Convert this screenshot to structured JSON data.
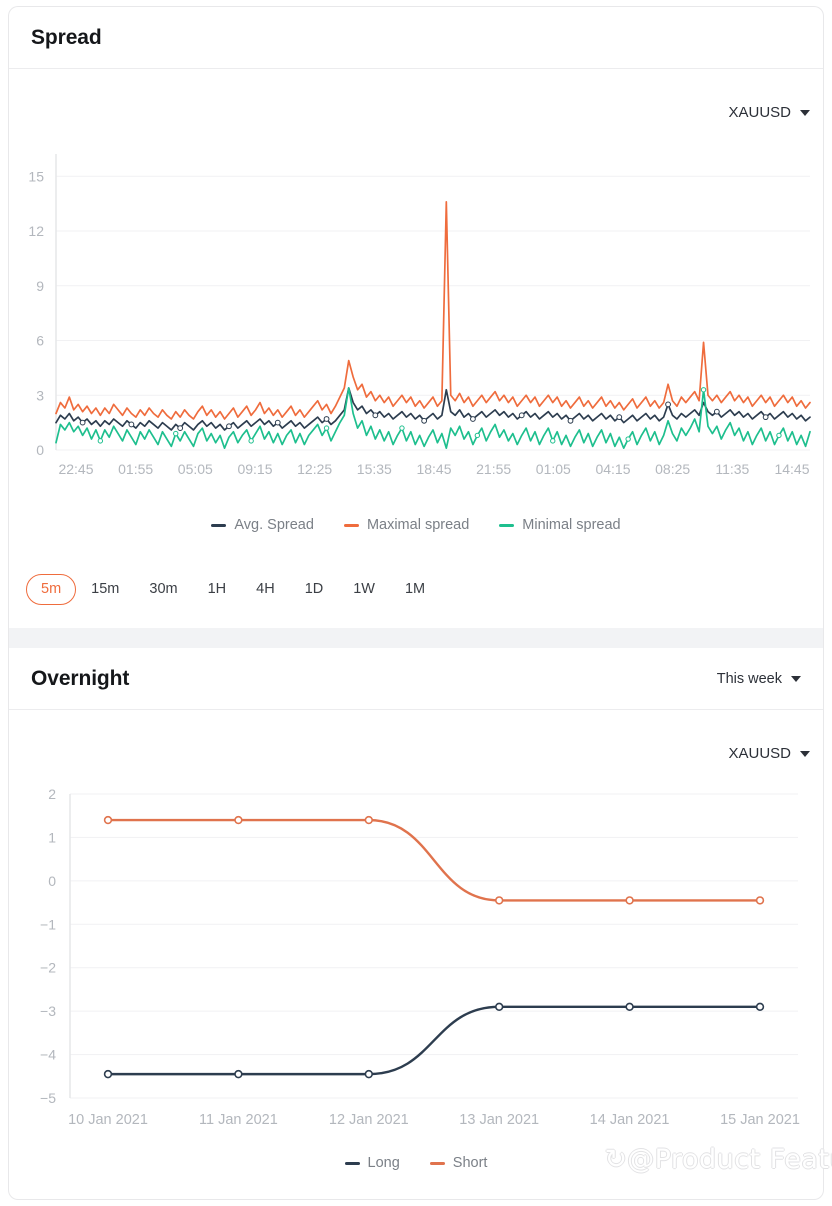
{
  "spread_card": {
    "title": "Spread",
    "symbol": "XAUUSD",
    "symbol_caret_icon": "chevron-down-icon",
    "range_buttons": [
      {
        "label": "5m",
        "active": true
      },
      {
        "label": "15m",
        "active": false
      },
      {
        "label": "30m",
        "active": false
      },
      {
        "label": "1H",
        "active": false
      },
      {
        "label": "4H",
        "active": false
      },
      {
        "label": "1D",
        "active": false
      },
      {
        "label": "1W",
        "active": false
      },
      {
        "label": "1M",
        "active": false
      }
    ]
  },
  "overnight_card": {
    "title": "Overnight",
    "period": "This week",
    "period_caret_icon": "chevron-down-icon",
    "symbol": "XAUUSD",
    "symbol_caret_icon": "chevron-down-icon"
  },
  "watermark": {
    "text": "@Product Features",
    "glyph": "↺"
  },
  "colors": {
    "orange": "#ef6c3d",
    "teal": "#1ebf8e",
    "navy": "#2d3d4f",
    "overnight_short": "#e0734d",
    "overnight_long": "#2d3d4f",
    "grid": "#f1f1f3",
    "tick_text": "#b3b7bd",
    "axis": "#e6e7e9"
  },
  "chart_data": [
    {
      "type": "line",
      "id": "spread-chart",
      "title": "Spread",
      "xlabel": "",
      "ylabel": "",
      "ylim": [
        0,
        16
      ],
      "yticks": [
        0,
        3,
        6,
        9,
        12,
        15
      ],
      "xticks": [
        "22:45",
        "01:55",
        "05:05",
        "09:15",
        "12:25",
        "15:35",
        "18:45",
        "21:55",
        "01:05",
        "04:15",
        "08:25",
        "11:35",
        "14:45"
      ],
      "grid": true,
      "legend_position": "bottom",
      "series": [
        {
          "name": "Avg. Spread",
          "color": "#2d3d4f",
          "values": [
            1.5,
            1.9,
            1.7,
            2.0,
            1.6,
            1.8,
            1.5,
            1.7,
            1.4,
            1.6,
            1.3,
            1.6,
            1.4,
            1.7,
            1.5,
            1.3,
            1.6,
            1.4,
            1.2,
            1.5,
            1.3,
            1.6,
            1.4,
            1.2,
            1.5,
            1.3,
            1.1,
            1.4,
            1.2,
            1.5,
            1.3,
            1.1,
            1.4,
            1.6,
            1.3,
            1.5,
            1.2,
            1.4,
            1.1,
            1.3,
            1.5,
            1.2,
            1.4,
            1.6,
            1.3,
            1.5,
            1.7,
            1.4,
            1.6,
            1.3,
            1.5,
            1.2,
            1.4,
            1.6,
            1.3,
            1.5,
            1.2,
            1.4,
            1.6,
            1.8,
            1.5,
            1.7,
            1.4,
            1.6,
            1.9,
            2.2,
            3.4,
            2.6,
            2.2,
            2.4,
            2.0,
            2.2,
            1.9,
            2.1,
            1.8,
            2.0,
            1.7,
            1.9,
            2.1,
            1.8,
            2.0,
            1.7,
            1.9,
            1.6,
            1.8,
            2.0,
            1.7,
            1.9,
            3.3,
            2.1,
            1.9,
            2.2,
            1.8,
            2.0,
            1.7,
            1.9,
            2.1,
            1.8,
            2.0,
            2.2,
            1.9,
            2.1,
            1.8,
            2.0,
            1.7,
            1.9,
            2.1,
            1.8,
            2.0,
            1.7,
            1.9,
            2.1,
            1.8,
            2.0,
            1.7,
            1.9,
            1.6,
            1.8,
            2.0,
            1.7,
            1.9,
            1.6,
            1.8,
            2.0,
            1.7,
            1.9,
            1.6,
            1.8,
            1.5,
            1.7,
            1.9,
            1.6,
            1.8,
            2.0,
            1.7,
            1.9,
            1.6,
            1.8,
            2.5,
            1.9,
            1.7,
            2.0,
            1.8,
            2.0,
            2.2,
            1.9,
            2.6,
            2.1,
            1.9,
            2.1,
            1.8,
            2.0,
            2.2,
            1.9,
            2.1,
            1.8,
            2.0,
            1.7,
            1.9,
            2.1,
            1.8,
            2.0,
            1.7,
            1.9,
            2.1,
            1.8,
            2.0,
            1.7,
            1.9,
            1.6,
            1.8
          ]
        },
        {
          "name": "Maximal spread",
          "color": "#ef6c3d",
          "values": [
            2.0,
            2.6,
            2.3,
            2.9,
            2.2,
            2.5,
            2.1,
            2.4,
            2.0,
            2.3,
            1.9,
            2.3,
            2.0,
            2.5,
            2.2,
            1.9,
            2.3,
            2.0,
            1.8,
            2.2,
            1.9,
            2.3,
            2.0,
            1.8,
            2.2,
            1.9,
            1.7,
            2.1,
            1.8,
            2.2,
            1.9,
            1.7,
            2.1,
            2.4,
            1.9,
            2.2,
            1.8,
            2.1,
            1.7,
            2.0,
            2.3,
            1.8,
            2.1,
            2.4,
            1.9,
            2.2,
            2.6,
            2.0,
            2.3,
            1.9,
            2.2,
            1.8,
            2.1,
            2.4,
            1.9,
            2.2,
            1.8,
            2.1,
            2.4,
            2.7,
            2.2,
            2.5,
            2.0,
            2.4,
            2.9,
            3.4,
            4.9,
            4.0,
            3.3,
            3.6,
            2.9,
            3.2,
            2.7,
            3.0,
            2.6,
            2.9,
            2.4,
            2.7,
            3.0,
            2.6,
            2.9,
            2.4,
            2.7,
            2.3,
            2.6,
            2.9,
            2.4,
            2.7,
            13.6,
            3.0,
            2.7,
            3.1,
            2.6,
            2.9,
            2.4,
            2.7,
            3.0,
            2.6,
            2.9,
            3.2,
            2.7,
            3.0,
            2.6,
            2.9,
            2.4,
            2.7,
            3.0,
            2.6,
            2.9,
            2.4,
            2.7,
            3.0,
            2.6,
            2.9,
            2.4,
            2.7,
            2.3,
            2.6,
            2.9,
            2.4,
            2.7,
            2.3,
            2.6,
            2.9,
            2.4,
            2.7,
            2.3,
            2.6,
            2.2,
            2.5,
            2.8,
            2.3,
            2.6,
            2.9,
            2.4,
            2.7,
            2.3,
            2.6,
            3.6,
            2.7,
            2.4,
            2.9,
            2.6,
            2.9,
            3.2,
            2.7,
            5.9,
            3.0,
            2.7,
            3.0,
            2.6,
            2.9,
            3.2,
            2.7,
            3.0,
            2.6,
            2.9,
            2.4,
            2.7,
            3.0,
            2.6,
            2.9,
            2.4,
            2.7,
            3.0,
            2.6,
            2.9,
            2.4,
            2.7,
            2.3,
            2.6
          ]
        },
        {
          "name": "Minimal spread",
          "color": "#1ebf8e",
          "values": [
            0.4,
            1.4,
            1.1,
            1.5,
            1.0,
            1.3,
            0.8,
            1.2,
            0.6,
            1.1,
            0.5,
            1.1,
            0.7,
            1.3,
            0.9,
            0.5,
            1.1,
            0.7,
            0.3,
            1.0,
            0.6,
            1.1,
            0.7,
            0.3,
            1.0,
            0.6,
            0.2,
            0.9,
            0.5,
            1.0,
            0.6,
            0.2,
            0.9,
            1.2,
            0.5,
            0.9,
            0.4,
            0.8,
            0.1,
            0.7,
            1.0,
            0.4,
            0.8,
            1.1,
            0.5,
            0.9,
            1.3,
            0.6,
            1.0,
            0.4,
            0.9,
            0.3,
            0.8,
            1.1,
            0.4,
            0.9,
            0.3,
            0.8,
            1.1,
            1.4,
            0.8,
            1.2,
            0.5,
            1.0,
            1.5,
            1.9,
            3.4,
            2.0,
            1.2,
            1.6,
            0.8,
            1.3,
            0.6,
            1.1,
            0.5,
            1.0,
            0.3,
            0.8,
            1.2,
            0.5,
            1.0,
            0.3,
            0.8,
            0.2,
            0.7,
            1.1,
            0.4,
            0.9,
            0.1,
            1.2,
            0.8,
            1.3,
            0.6,
            1.0,
            0.3,
            0.8,
            1.2,
            0.5,
            1.0,
            1.4,
            0.7,
            1.1,
            0.5,
            0.9,
            0.3,
            0.8,
            1.2,
            0.5,
            1.0,
            0.3,
            0.8,
            1.2,
            0.5,
            1.0,
            0.3,
            0.8,
            0.2,
            0.7,
            1.1,
            0.4,
            0.9,
            0.2,
            0.7,
            1.1,
            0.4,
            0.9,
            0.2,
            0.7,
            0.1,
            0.6,
            1.0,
            0.3,
            0.8,
            1.2,
            0.5,
            1.0,
            0.3,
            0.8,
            1.6,
            0.9,
            0.5,
            1.2,
            0.8,
            1.2,
            1.7,
            1.0,
            3.3,
            1.3,
            0.9,
            1.3,
            0.6,
            1.1,
            1.5,
            0.8,
            1.2,
            0.5,
            1.0,
            0.3,
            0.8,
            1.2,
            0.5,
            1.0,
            0.3,
            0.8,
            1.2,
            0.5,
            1.0,
            0.3,
            0.8,
            0.2,
            1.0
          ]
        }
      ]
    },
    {
      "type": "line",
      "id": "overnight-chart",
      "title": "Overnight",
      "xlabel": "",
      "ylabel": "",
      "ylim": [
        -5,
        2
      ],
      "yticks": [
        2,
        1,
        0,
        -1,
        -2,
        -3,
        -4,
        -5
      ],
      "categories": [
        "10 Jan 2021",
        "11 Jan 2021",
        "12 Jan 2021",
        "13 Jan 2021",
        "14 Jan 2021",
        "15 Jan 2021"
      ],
      "grid": true,
      "legend_position": "bottom",
      "series": [
        {
          "name": "Short",
          "color": "#e0734d",
          "values": [
            1.4,
            1.4,
            1.4,
            -0.45,
            -0.45,
            -0.45
          ]
        },
        {
          "name": "Long",
          "color": "#2d3d4f",
          "values": [
            -4.45,
            -4.45,
            -4.45,
            -2.9,
            -2.9,
            -2.9
          ]
        }
      ]
    }
  ]
}
